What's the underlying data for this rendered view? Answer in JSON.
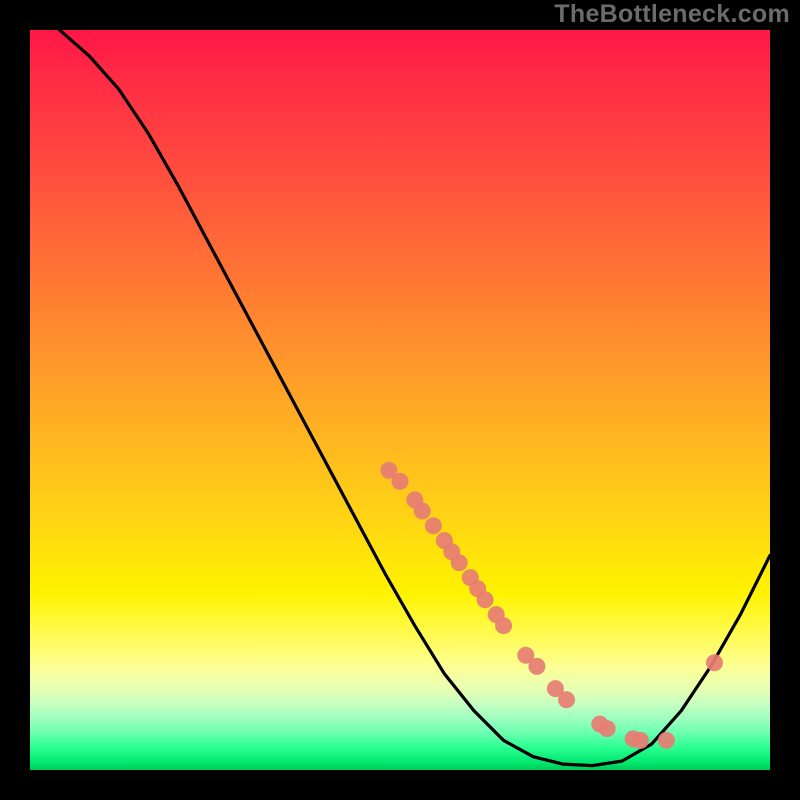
{
  "watermark": "TheBottleneck.com",
  "colors": {
    "background": "#000000",
    "curve": "#000000",
    "marker": "#e77d74",
    "watermark": "#6b6b6b"
  },
  "chart_data": {
    "type": "line",
    "title": "",
    "xlabel": "",
    "ylabel": "",
    "xlim": [
      0,
      100
    ],
    "ylim": [
      0,
      100
    ],
    "grid": false,
    "series": [
      {
        "name": "bottleneck-curve",
        "x": [
          0,
          4,
          8,
          12,
          16,
          20,
          24,
          28,
          32,
          36,
          40,
          44,
          48,
          52,
          56,
          60,
          64,
          68,
          72,
          76,
          80,
          84,
          88,
          92,
          96,
          100
        ],
        "y": [
          104,
          100,
          96.5,
          92,
          86,
          79,
          71.5,
          64,
          56.5,
          49,
          41.5,
          34,
          26.5,
          19.5,
          13,
          8,
          4,
          1.8,
          0.8,
          0.6,
          1.2,
          3.5,
          8,
          14,
          21,
          29
        ]
      }
    ],
    "markers": {
      "name": "highlighted-points",
      "x": [
        48.5,
        50,
        52,
        53,
        54.5,
        56,
        57,
        58,
        59.5,
        60.5,
        61.5,
        63,
        64,
        67,
        68.5,
        71,
        72.5,
        77,
        78,
        81.5,
        82.5,
        86,
        92.5
      ],
      "y": [
        40.5,
        39,
        36.5,
        35,
        33,
        31,
        29.5,
        28,
        26,
        24.5,
        23,
        21,
        19.5,
        15.5,
        14,
        11,
        9.5,
        6.2,
        5.6,
        4.2,
        4.0,
        4.0,
        14.5
      ]
    }
  }
}
